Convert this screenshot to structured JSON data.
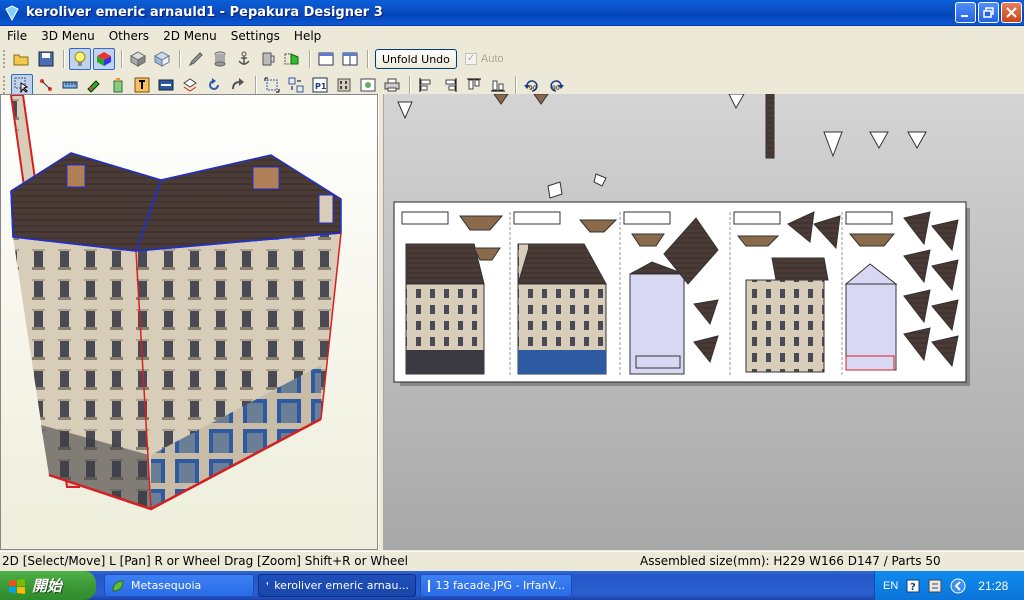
{
  "window": {
    "title": "keroliver emeric arnauld1 - Pepakura Designer 3"
  },
  "menu": [
    "File",
    "3D Menu",
    "Others",
    "2D Menu",
    "Settings",
    "Help"
  ],
  "toolbar": {
    "unfold_undo_label": "Unfold Undo",
    "auto_label": "Auto"
  },
  "status": {
    "left": "2D [Select/Move] L [Pan] R or Wheel Drag [Zoom] Shift+R or Wheel",
    "right": "Assembled size(mm): H229 W166 D147 / Parts 50"
  },
  "taskbar": {
    "start_label": "開始",
    "tasks": [
      "Metasequoia",
      "keroliver emeric arnau...",
      "13 facade.JPG - IrfanV..."
    ],
    "language": "EN",
    "clock": "21:28"
  },
  "colors": {
    "accent": "#0a5fd8",
    "edge_red": "#d42020",
    "edge_blue": "#2030d0",
    "roof": "#4a3b36",
    "facade": "#d8cdb8"
  }
}
